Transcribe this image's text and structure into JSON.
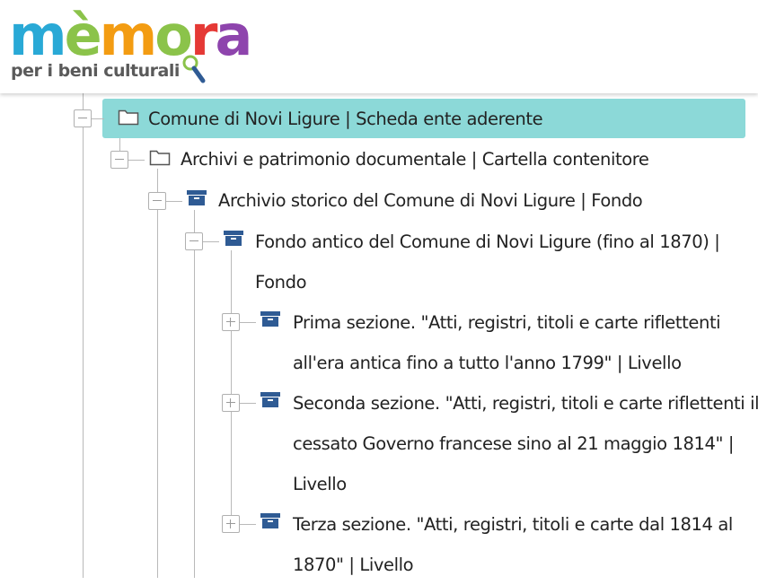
{
  "logo": {
    "wordmark": [
      "m",
      "è",
      "m",
      "o",
      "r",
      "a"
    ],
    "wordmark_colors": [
      "#29a9d6",
      "#8bc34a",
      "#f39c12",
      "#8bc34a",
      "#e53935",
      "#8e44ad"
    ],
    "tagline": "per i beni culturali"
  },
  "tree": {
    "nodes": [
      {
        "line1": "Comune di Novi Ligure | Scheda ente aderente",
        "icon": "folder-outline-icon",
        "toggle": "collapse",
        "selected": true
      },
      {
        "line1": "Archivi e patrimonio documentale | Cartella contenitore",
        "icon": "folder-outline-icon",
        "toggle": "collapse"
      },
      {
        "line1": "Archivio storico del Comune di Novi Ligure | Fondo",
        "icon": "archive-box-icon",
        "toggle": "collapse"
      },
      {
        "line1": "Fondo antico del Comune di Novi Ligure (fino al 1870) |",
        "line2": "Fondo",
        "icon": "archive-box-icon",
        "toggle": "collapse"
      },
      {
        "line1": "Prima sezione. \"Atti, registri, titoli e carte riflettenti",
        "line2": "all'era antica fino a tutto l'anno 1799\" | Livello",
        "icon": "archive-box-icon",
        "toggle": "expand"
      },
      {
        "line1": "Seconda sezione. \"Atti, registri, titoli e carte riflettenti il",
        "line2": "cessato Governo francese sino al 21 maggio 1814\" |",
        "line3": "Livello",
        "icon": "archive-box-icon",
        "toggle": "expand"
      },
      {
        "line1": "Terza sezione. \"Atti, registri, titoli e carte dal 1814 al",
        "line2": "1870\" | Livello",
        "icon": "archive-box-icon",
        "toggle": "expand"
      }
    ]
  },
  "colors": {
    "selected_bg": "#8cd9d8",
    "archive_icon": "#2f5b94",
    "tree_lines": "#b9b9b9"
  }
}
